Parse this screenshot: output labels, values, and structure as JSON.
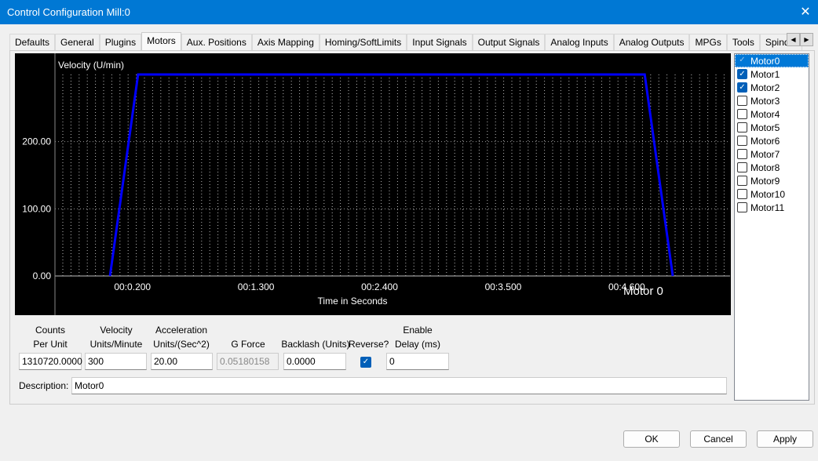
{
  "window": {
    "title": "Control Configuration Mill:0",
    "close_icon": "close-icon"
  },
  "tabs": [
    "Defaults",
    "General",
    "Plugins",
    "Motors",
    "Aux. Positions",
    "Axis Mapping",
    "Homing/SoftLimits",
    "Input Signals",
    "Output Signals",
    "Analog Inputs",
    "Analog Outputs",
    "MPGs",
    "Tools",
    "Spindle"
  ],
  "active_tab": "Motors",
  "chart_data": {
    "type": "line",
    "title": "Velocity (U/min)",
    "xlabel": "Time in Seconds",
    "ylabel": "Velocity (U/min)",
    "x_tick_labels": [
      "00:0.200",
      "00:1.300",
      "00:2.400",
      "00:3.500",
      "00:4.600"
    ],
    "x_ticks": [
      0.2,
      1.3,
      2.4,
      3.5,
      4.6
    ],
    "y_tick_labels": [
      "0.00",
      "100.00",
      "200.00"
    ],
    "y_ticks": [
      0,
      100,
      200
    ],
    "xlim": [
      -0.49,
      5.52
    ],
    "ylim": [
      0,
      300
    ],
    "grid": true,
    "legend_text": "Motor 0",
    "series": [
      {
        "name": "Motor 0",
        "color": "#0000ff",
        "x": [
          0,
          0.25,
          4.76,
          5.01
        ],
        "y": [
          0,
          300,
          300,
          0
        ]
      }
    ]
  },
  "motors": [
    {
      "label": "Motor0",
      "checked": true,
      "selected": true
    },
    {
      "label": "Motor1",
      "checked": true
    },
    {
      "label": "Motor2",
      "checked": true
    },
    {
      "label": "Motor3",
      "checked": false
    },
    {
      "label": "Motor4",
      "checked": false
    },
    {
      "label": "Motor5",
      "checked": false
    },
    {
      "label": "Motor6",
      "checked": false
    },
    {
      "label": "Motor7",
      "checked": false
    },
    {
      "label": "Motor8",
      "checked": false
    },
    {
      "label": "Motor9",
      "checked": false
    },
    {
      "label": "Motor10",
      "checked": false
    },
    {
      "label": "Motor11",
      "checked": false
    }
  ],
  "fields": {
    "counts_label1": "Counts",
    "counts_label2": "Per Unit",
    "counts": "1310720.0000",
    "vel_label1": "Velocity",
    "vel_label2": "Units/Minute",
    "vel": "300",
    "acc_label1": "Acceleration",
    "acc_label2": "Units/(Sec^2)",
    "acc": "20.00",
    "g_label": "G Force",
    "g": "0.05180158",
    "backlash_label": "Backlash (Units)",
    "backlash": "0.0000",
    "reverse_label": "Reverse?",
    "reverse": true,
    "delay_label1": "Enable",
    "delay_label2": "Delay (ms)",
    "delay": "0",
    "desc_label": "Description:",
    "desc": "Motor0"
  },
  "buttons": {
    "ok": "OK",
    "cancel": "Cancel",
    "apply": "Apply"
  }
}
